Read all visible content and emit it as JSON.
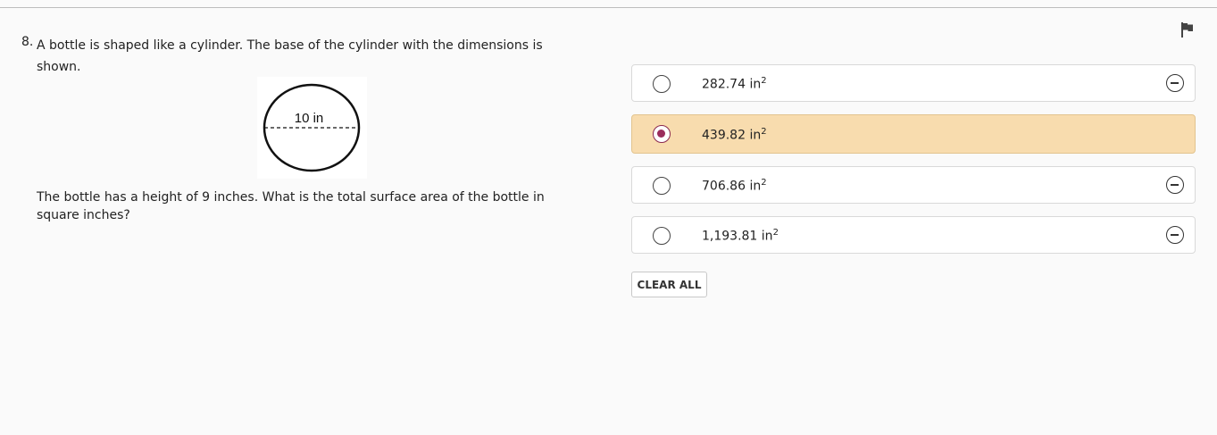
{
  "question": {
    "number": "8.",
    "text_part1": "A bottle is shaped like a cylinder. The base of the cylinder with the dimensions is shown.",
    "figure_label": "10 in",
    "text_part2": "The bottle has a height of 9 inches. What is the total surface area of the bottle in square inches?"
  },
  "choices": [
    {
      "value": "282.74",
      "unit": "in",
      "exponent": "2",
      "selected": false
    },
    {
      "value": "439.82",
      "unit": "in",
      "exponent": "2",
      "selected": true
    },
    {
      "value": "706.86",
      "unit": "in",
      "exponent": "2",
      "selected": false
    },
    {
      "value": "1,193.81",
      "unit": "in",
      "exponent": "2",
      "selected": false
    }
  ],
  "clear_all_label": "CLEAR ALL",
  "icons": {
    "flag": "flag-icon",
    "strike": "eliminate-choice-icon",
    "radio": "radio-button"
  },
  "colors": {
    "selected_bg": "#f8dcae",
    "selected_border": "#e2c48f",
    "radio_dot": "#9b2d5c"
  }
}
